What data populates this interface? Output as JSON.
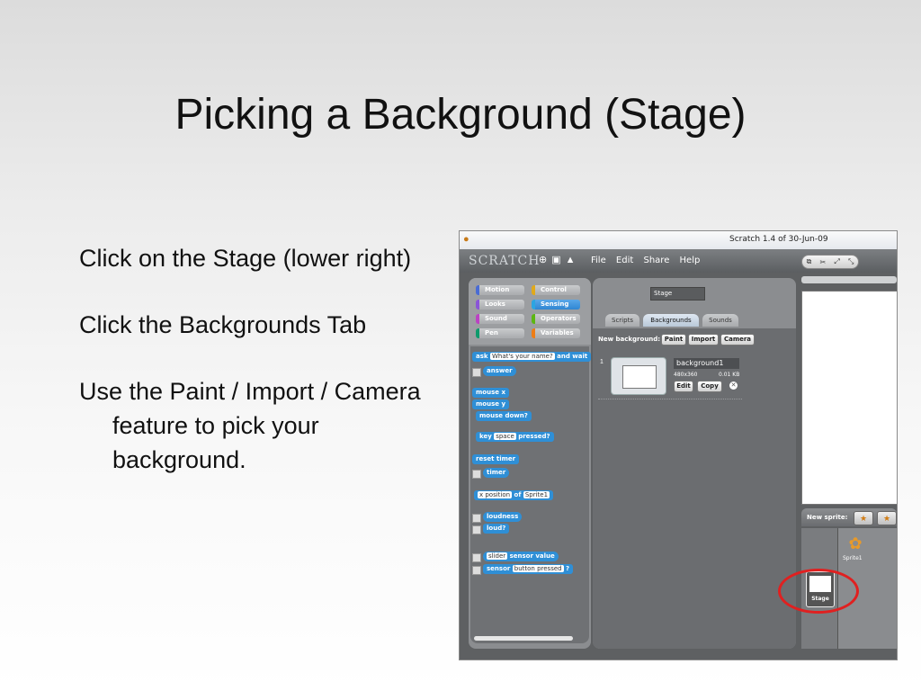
{
  "slide": {
    "title": "Picking a Background (Stage)",
    "bullets": [
      "Click on the Stage (lower right)",
      "Click the Backgrounds Tab",
      "Use the Paint / Import / Camera feature to pick your background."
    ]
  },
  "window": {
    "title": "Scratch 1.4 of 30-Jun-09",
    "logo": "SCRATCH",
    "menu": [
      "File",
      "Edit",
      "Share",
      "Help"
    ]
  },
  "palette": {
    "categories": [
      "Motion",
      "Control",
      "Looks",
      "Sensing",
      "Sound",
      "Operators",
      "Pen",
      "Variables"
    ],
    "active_category": "Sensing",
    "blocks": {
      "ask": "ask",
      "ask_slot": "What's your name?",
      "and_wait": "and wait",
      "answer": "answer",
      "mouse_x": "mouse x",
      "mouse_y": "mouse y",
      "mouse_down": "mouse down?",
      "key": "key",
      "key_slot": "space",
      "pressed": "pressed?",
      "reset_timer": "reset timer",
      "timer": "timer",
      "x_position": "x position",
      "of": "of",
      "sprite1": "Sprite1",
      "loudness": "loudness",
      "loud": "loud?",
      "slider": "slider",
      "sensor_value": "sensor value",
      "sensor": "sensor",
      "button_pressed": "button pressed",
      "question": "?"
    }
  },
  "scripts": {
    "sprite_name": "Stage",
    "tabs": [
      "Scripts",
      "Backgrounds",
      "Sounds"
    ],
    "active_tab": "Backgrounds",
    "new_background_label": "New background:",
    "buttons": {
      "paint": "Paint",
      "import": "Import",
      "camera": "Camera"
    },
    "background": {
      "index": "1",
      "name": "background1",
      "size": "480x360",
      "kb": "0.01 KB",
      "edit": "Edit",
      "copy": "Copy"
    }
  },
  "sprites": {
    "new_sprite_label": "New sprite:",
    "sprite_label": "Sprite1",
    "stage_label": "Stage"
  },
  "colors": {
    "highlight_circle": "#e02020",
    "sensing_blue": "#2f8fd6"
  }
}
